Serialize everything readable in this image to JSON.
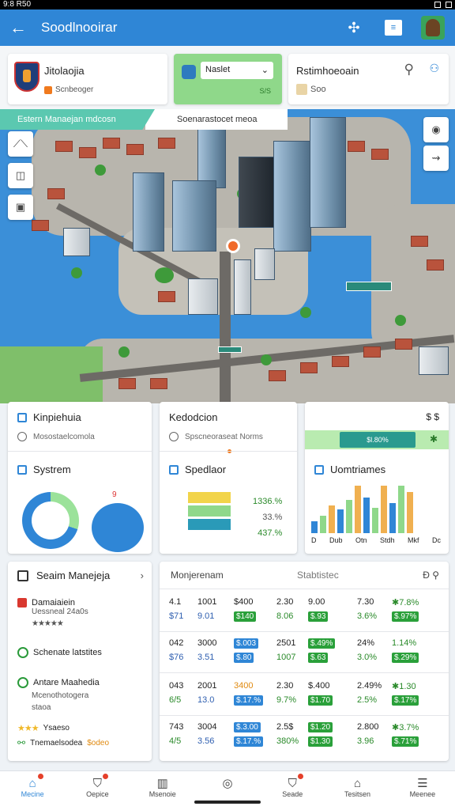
{
  "status_bar": {
    "time": "9:8 R50"
  },
  "app_bar": {
    "title": "Soodlnooirar",
    "doc_label": "≡"
  },
  "top_cards": {
    "card1": {
      "title": "Jitolaojia",
      "subtitle": "Scnbeoger"
    },
    "card2": {
      "select_value": "Naslet",
      "sub": "S/S"
    },
    "card3": {
      "title": "Rstimhoeoain",
      "subtitle": "Soo"
    }
  },
  "map": {
    "banner_left": "Estern Manaejan mdcosn",
    "banner_right": "Soenarastocet meoa"
  },
  "mid_cards": {
    "card1": {
      "title": "Kinpiehuia",
      "subtitle": "Mosostaelcomola",
      "section": "Systrem",
      "pie_label": "9"
    },
    "card2": {
      "title": "Kedodcion",
      "subtitle": "Spscneoraseat Norms",
      "section": "Spedlaor",
      "pcts": [
        "1336.%",
        "33.%",
        "437.%"
      ]
    },
    "card3": {
      "mark": "$ $",
      "pill": "$l.80%",
      "star": "✱",
      "section": "Uomtriames",
      "xlabels": [
        "D",
        "Dub",
        "Otn",
        "Stdh",
        "Mkf",
        "Dc"
      ]
    }
  },
  "chart_data": {
    "type": "bar",
    "categories": [
      "D",
      "Dub",
      "Otn",
      "Stdh",
      "Mkf",
      "Dc"
    ],
    "series": [
      {
        "values": [
          15,
          22,
          35,
          30,
          42,
          60,
          45,
          32,
          60,
          38,
          60,
          52
        ]
      }
    ],
    "colors": [
      "#2f86d6",
      "#8fd88a",
      "#f0b050"
    ]
  },
  "bottom_left": {
    "title": "Seaim Manejeja",
    "items": [
      {
        "title": "Damaiaiein",
        "sub": "Uessneal 24a0s",
        "stars": "★★★★★"
      },
      {
        "title": "Schenate latstites"
      },
      {
        "title": "Antare Maahedia",
        "sub": "Mcenothotogera",
        "sub2": "staoa"
      },
      {
        "stars": "★★★",
        "label": "Ysaeso"
      },
      {
        "title": "Tnemaelsodea",
        "orange": "$odeo"
      }
    ]
  },
  "table": {
    "head1": "Monjerenam",
    "head2": "Stabtistec",
    "head3": "Ð ⚲",
    "rows": [
      {
        "a": [
          "4.1",
          "1001",
          "$400",
          "2.30",
          "9.00",
          "7.30",
          "✱7.8%"
        ],
        "b": [
          "$71",
          "9.01",
          "$140",
          "8.06",
          "$.93",
          "3.6%",
          "$.97%"
        ]
      },
      {
        "a": [
          "042",
          "3000",
          "$.003",
          "2501",
          "$.49%",
          "24%",
          "1.14%"
        ],
        "b": [
          "$76",
          "3.51",
          "$.80",
          "1007",
          "$.63",
          "3.0%",
          "$.29%"
        ]
      },
      {
        "a": [
          "043",
          "2001",
          "3400",
          "2.30",
          "$.400",
          "2.49%",
          "✱1.30"
        ],
        "b": [
          "6/5",
          "13.0",
          "$.17.%",
          "9.7%",
          "$1.70",
          "2.5%",
          "$.17%"
        ]
      },
      {
        "a": [
          "743",
          "3004",
          "$.3.00",
          "2.5$",
          "$1.20",
          "2.800",
          "✱3.7%"
        ],
        "b": [
          "4/5",
          "3.56",
          "$.17.%",
          "380%",
          "$1.30",
          "3.96",
          "$.71%"
        ]
      }
    ]
  },
  "bottom_nav": [
    {
      "label": "Mecine",
      "icon": "home-icon"
    },
    {
      "label": "Oepice",
      "icon": "shield-icon"
    },
    {
      "label": "Msenoie",
      "icon": "building-icon"
    },
    {
      "label": "",
      "icon": "location-icon"
    },
    {
      "label": "Seade",
      "icon": "shield-alert-icon"
    },
    {
      "label": "Tesitsen",
      "icon": "home-outline-icon"
    },
    {
      "label": "Meenee",
      "icon": "menu-icon"
    }
  ]
}
